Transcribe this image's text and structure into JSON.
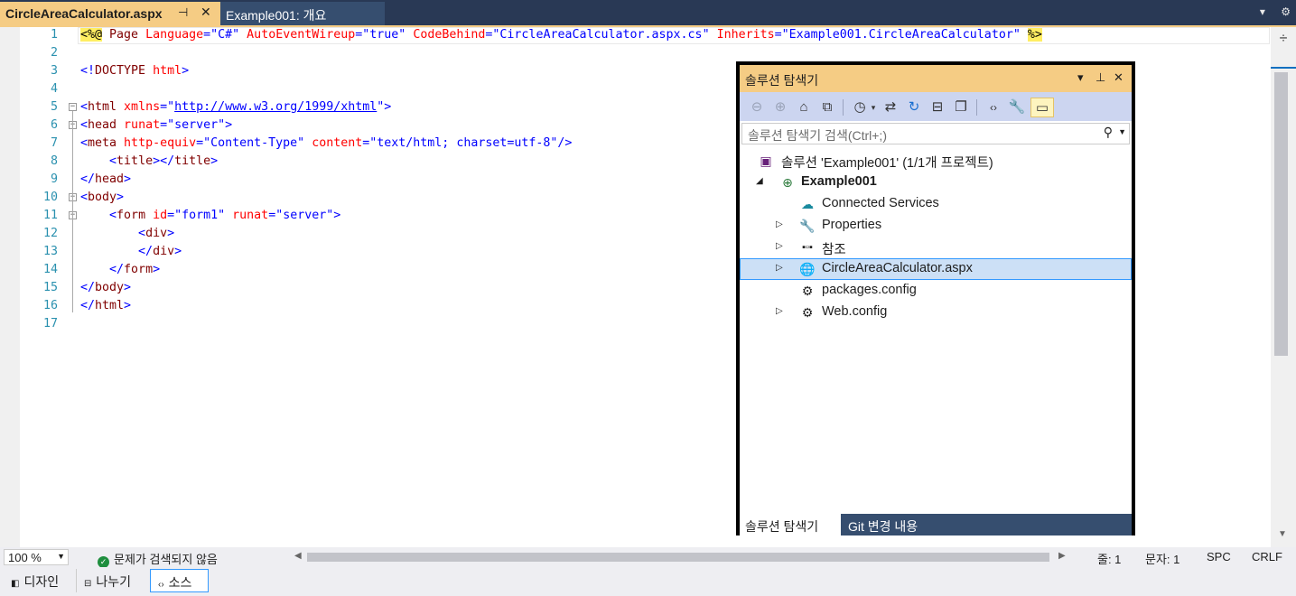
{
  "tabs": {
    "active": {
      "label": "CircleAreaCalculator.aspx",
      "pin": "⊣",
      "close": "✕"
    },
    "inactive": {
      "label": "Example001: 개요"
    },
    "right_icons": {
      "dropdown": "▾",
      "settings": "⚙"
    }
  },
  "editor": {
    "line_numbers": [
      "1",
      "2",
      "3",
      "4",
      "5",
      "6",
      "7",
      "8",
      "9",
      "10",
      "11",
      "12",
      "13",
      "14",
      "15",
      "16",
      "17"
    ],
    "lines": {
      "l1": {
        "open": "<%@",
        "page": " Page ",
        "a1": "Language",
        "eq": "=",
        "v1": "\"C#\"",
        "a2": " AutoEventWireup",
        "v2": "\"true\"",
        "a3": " CodeBehind",
        "v3": "\"CircleAreaCalculator.aspx.cs\"",
        "a4": " Inherits",
        "v4": "\"Example001.CircleAreaCalculator\"",
        "close": "%>"
      },
      "l3": {
        "b1": "<!",
        "t": "DOCTYPE",
        "a": " html",
        "b2": ">"
      },
      "l5": {
        "b1": "<",
        "t": "html",
        "a": " xmlns",
        "eq": "=\"",
        "link": "http://www.w3.org/1999/xhtml",
        "q": "\"",
        "b2": ">"
      },
      "l6": {
        "b1": "<",
        "t": "head",
        "a": " runat",
        "v": "=\"server\"",
        "b2": ">"
      },
      "l7": {
        "b1": "<",
        "t": "meta",
        "a1": " http-equiv",
        "v1": "=\"Content-Type\"",
        "a2": " content",
        "v2": "=\"text/html; charset=utf-8\"",
        "b2": "/>"
      },
      "l8": {
        "indent": "    ",
        "b1": "<",
        "t": "title",
        "b2": "></",
        "t2": "title",
        "b3": ">"
      },
      "l9": {
        "b1": "</",
        "t": "head",
        "b2": ">"
      },
      "l10": {
        "b1": "<",
        "t": "body",
        "b2": ">"
      },
      "l11": {
        "indent": "    ",
        "b1": "<",
        "t": "form",
        "a1": " id",
        "v1": "=\"form1\"",
        "a2": " runat",
        "v2": "=\"server\"",
        "b2": ">"
      },
      "l12": {
        "indent": "        ",
        "b1": "<",
        "t": "div",
        "b2": ">"
      },
      "l13": {
        "indent": "        ",
        "b1": "</",
        "t": "div",
        "b2": ">"
      },
      "l14": {
        "indent": "    ",
        "b1": "</",
        "t": "form",
        "b2": ">"
      },
      "l15": {
        "b1": "</",
        "t": "body",
        "b2": ">"
      },
      "l16": {
        "b1": "</",
        "t": "html",
        "b2": ">"
      }
    }
  },
  "solution_explorer": {
    "title": "솔루션 탐색기",
    "title_controls": {
      "dropdown": "▾",
      "pin": "⊥",
      "close": "✕"
    },
    "search_placeholder": "솔루션 탐색기 검색(Ctrl+;)",
    "tree": [
      {
        "label": "솔루션 'Example001' (1/1개 프로젝트)",
        "icon": "solution-icon"
      },
      {
        "label": "Example001",
        "icon": "web-project-icon",
        "expander": "◢"
      },
      {
        "label": "Connected Services",
        "icon": "connected-services-icon"
      },
      {
        "label": "Properties",
        "icon": "wrench-icon",
        "expander": "▷"
      },
      {
        "label": "참조",
        "icon": "references-icon",
        "expander": "▷"
      },
      {
        "label": "CircleAreaCalculator.aspx",
        "icon": "aspx-file-icon",
        "expander": "▷"
      },
      {
        "label": "packages.config",
        "icon": "config-file-icon"
      },
      {
        "label": "Web.config",
        "icon": "config-file-icon",
        "expander": "▷"
      }
    ],
    "bottom_tabs": {
      "active": "솔루션 탐색기",
      "other": "Git 변경 내용"
    }
  },
  "status": {
    "zoom": "100 %",
    "issues": "문제가 검색되지 않음",
    "line": "줄: 1",
    "col": "문자: 1",
    "spc": "SPC",
    "eol": "CRLF"
  },
  "view_bar": {
    "design": "디자인",
    "split": "나누기",
    "source": "소스"
  },
  "colors": {
    "accent_tab": "#f5cc84",
    "frame": "#293955",
    "toolbar": "#ccd5f0",
    "selection": "#cce0f6"
  }
}
